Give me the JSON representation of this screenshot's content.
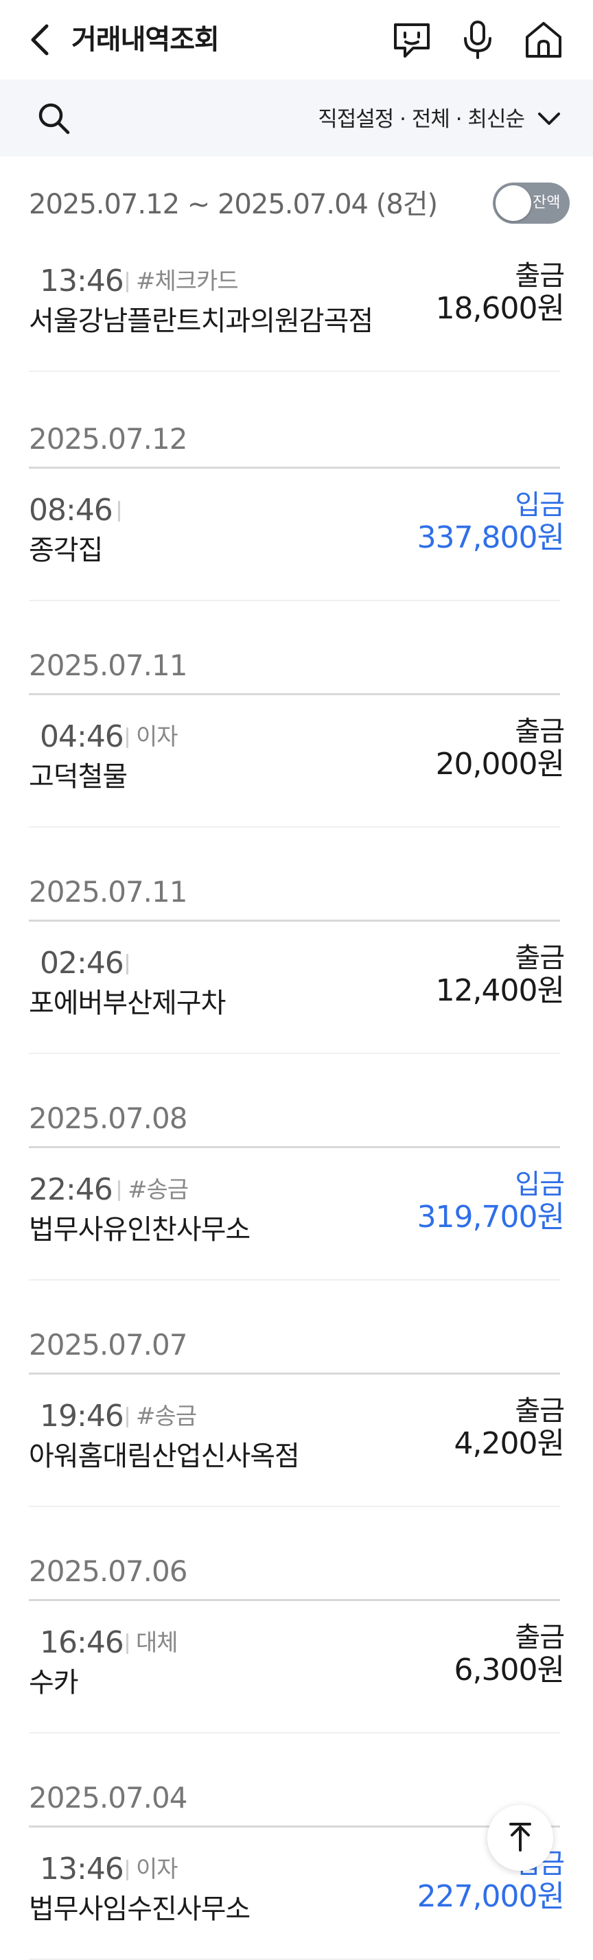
{
  "header": {
    "title": "거래내역조회",
    "icons": [
      "back-arrow-icon",
      "chat-bot-icon",
      "microphone-icon",
      "home-icon"
    ]
  },
  "filter": {
    "summary": "직접설정 · 전체 · 최신순",
    "search_icon": "search-icon",
    "chevron_icon": "chevron-down-icon"
  },
  "range": {
    "text": "2025.07.12 ~ 2025.07.04 (8건)",
    "toggle_label": "잔액",
    "toggle_on": false
  },
  "colors": {
    "deposit": "#2f6fe8",
    "withdraw": "#1a1a1a",
    "toggle_bg": "#8a929c"
  },
  "transactions": [
    {
      "date": "",
      "time": "13:46",
      "tag": "#체크카드",
      "name": "서울강남플란트치과의원감곡점",
      "type": "출금",
      "amount": "18,600원",
      "kind": "out"
    },
    {
      "date": "2025.07.12",
      "time": "08:46",
      "tag": "",
      "name": "종각집",
      "type": "입금",
      "amount": "337,800원",
      "kind": "in"
    },
    {
      "date": "2025.07.11",
      "time": "04:46",
      "tag": "이자",
      "name": "고덕철물",
      "type": "출금",
      "amount": "20,000원",
      "kind": "out"
    },
    {
      "date": "2025.07.11",
      "time": "02:46",
      "tag": "",
      "name": "포에버부산제구차",
      "type": "출금",
      "amount": "12,400원",
      "kind": "out"
    },
    {
      "date": "2025.07.08",
      "time": "22:46",
      "tag": "#송금",
      "name": "법무사유인찬사무소",
      "type": "입금",
      "amount": "319,700원",
      "kind": "in"
    },
    {
      "date": "2025.07.07",
      "time": "19:46",
      "tag": "#송금",
      "name": "아워홈대림산업신사옥점",
      "type": "출금",
      "amount": "4,200원",
      "kind": "out"
    },
    {
      "date": "2025.07.06",
      "time": "16:46",
      "tag": "대체",
      "name": "수카",
      "type": "출금",
      "amount": "6,300원",
      "kind": "out"
    },
    {
      "date": "2025.07.04",
      "time": "13:46",
      "tag": "이자",
      "name": "법무사임수진사무소",
      "type": "입금",
      "amount": "227,000원",
      "kind": "in"
    }
  ],
  "scroll_top_icon": "arrow-up-icon"
}
